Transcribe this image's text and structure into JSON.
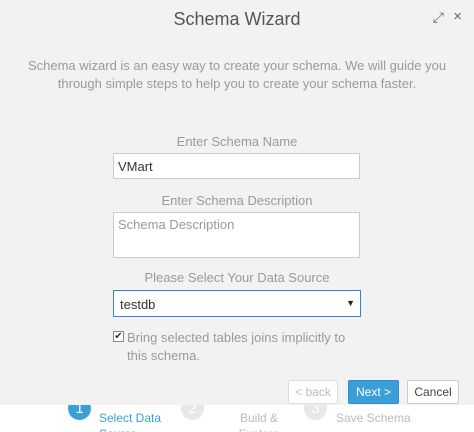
{
  "dialog": {
    "title": "Schema Wizard",
    "expand_icon": "expand-icon",
    "close_icon": "close-icon",
    "intro": "Schema wizard is an easy way to create your schema. We will guide you through simple steps to help you to create your schema faster."
  },
  "form": {
    "name_label": "Enter Schema Name",
    "name_value": "VMart",
    "desc_label": "Enter Schema Description",
    "desc_placeholder": "Schema Description",
    "source_label": "Please Select Your Data Source",
    "source_value": "testdb",
    "checkbox_checked": true,
    "checkbox_label": "Bring selected tables joins implicitly to this schema."
  },
  "buttons": {
    "back": "< back",
    "next": "Next >",
    "cancel": "Cancel"
  },
  "steps": [
    {
      "number": "1",
      "label": "Select Data Source",
      "active": true
    },
    {
      "number": "2",
      "label": "Build & Explore",
      "active": false
    },
    {
      "number": "3",
      "label": "Save Schema",
      "active": false
    }
  ],
  "colors": {
    "accent": "#3a9fd9",
    "background": "#f2f2f2"
  }
}
